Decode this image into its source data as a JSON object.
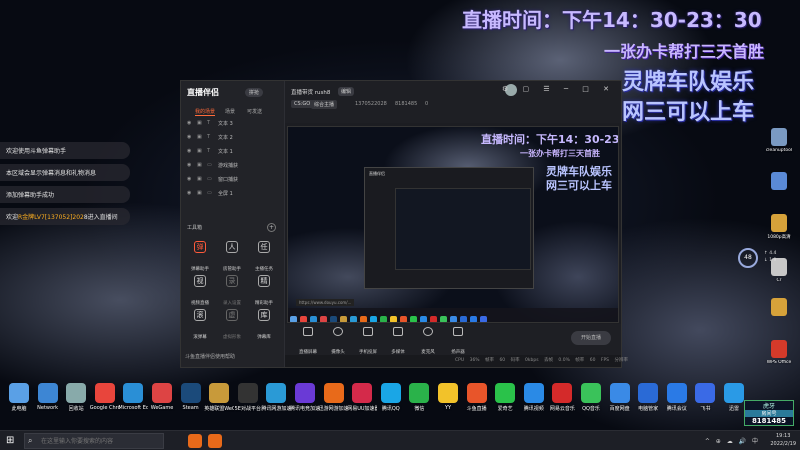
{
  "overlay": {
    "time": "直播时间：下午14：30-23：30",
    "promo": "一张办卡帮打三天首胜",
    "team": "灵牌车队娱乐",
    "net": "网三可以上车"
  },
  "chat": [
    {
      "text": "欢迎使用斗鱼弹幕助手"
    },
    {
      "text": "本区域会显示弹幕消息和礼物消息"
    },
    {
      "text": "添加弹幕助手成功"
    },
    {
      "prefix": "欢迎",
      "highlight": "R金牌LV7",
      "mid": "[137052]202",
      "suffix": "8进入直播间"
    }
  ],
  "app": {
    "logo": "直播伴侣",
    "logo_badge": "拼抢",
    "sidebar_tabs": [
      "我的场景",
      "场景",
      "可发送"
    ],
    "sources": [
      {
        "type": "T",
        "name": "文本 3"
      },
      {
        "type": "T",
        "name": "文本 2"
      },
      {
        "type": "T",
        "name": "文本 1"
      },
      {
        "type": "▭",
        "name": "游戏捕获"
      },
      {
        "type": "▭",
        "name": "窗口捕获"
      },
      {
        "type": "▭",
        "name": "全屏 1"
      }
    ],
    "toolbox_title": "工具箱",
    "tools": [
      {
        "label": "弹幕助手",
        "icon": "弹",
        "style": "red"
      },
      {
        "label": "房管助手",
        "icon": "人",
        "style": ""
      },
      {
        "label": "主播任务",
        "icon": "任",
        "style": ""
      },
      {
        "label": "视频直播",
        "icon": "视",
        "style": ""
      },
      {
        "label": "录入设置",
        "icon": "录",
        "style": "dim"
      },
      {
        "label": "精彩助手",
        "icon": "精",
        "style": ""
      },
      {
        "label": "滚弹幕",
        "icon": "滚",
        "style": ""
      },
      {
        "label": "虚拟形象",
        "icon": "虚",
        "style": "dim"
      },
      {
        "label": "弹幕库",
        "icon": "库",
        "style": ""
      }
    ],
    "helper_text": "斗鱼直播伴侣使用帮助",
    "room_title": "直播带货 rush8",
    "room_badge": "编辑",
    "game_tag": "CS:GO",
    "cat_tag": "综合主播",
    "room_id": "1370522028",
    "hot": "8181485",
    "fans": "0",
    "window_controls": "⚙ ▢ ☰ ─ □ ✕",
    "controls": [
      {
        "label": "直播屏幕"
      },
      {
        "label": "摄像头"
      },
      {
        "label": "手机投屏"
      },
      {
        "label": "多媒体"
      },
      {
        "label": "麦克风"
      },
      {
        "label": "扬声器"
      }
    ],
    "start_button": "开始直播",
    "status": "CPU 36% 帧率 60  码率 0kbps  丢帧 0.0%  帧率 60 FPS  分辨率"
  },
  "preview": {
    "time": "直播时间：下午14：30-23：30",
    "promo": "一张办卡帮打三天首胜",
    "team": "灵牌车队娱乐",
    "net": "网三可以上车",
    "inner_title": "直播伴侣",
    "url": "https://www.douyu.com/..."
  },
  "desktop_icons": [
    {
      "label": "此电脑",
      "color": "#5aa0e6"
    },
    {
      "label": "Network",
      "color": "#3d86d4"
    },
    {
      "label": "回收站",
      "color": "#8aa"
    },
    {
      "label": "Google Chrome",
      "color": "#e8453c"
    },
    {
      "label": "Microsoft Edge",
      "color": "#2a8fd6"
    },
    {
      "label": "WeGame",
      "color": "#d44"
    },
    {
      "label": "Steam",
      "color": "#1b4a7a"
    },
    {
      "label": "英雄联盟WeGame版",
      "color": "#c89a3a"
    },
    {
      "label": "5E对战平台",
      "color": "#333"
    },
    {
      "label": "腾讯网游加速器",
      "color": "#2a9ad6"
    },
    {
      "label": "腾讯电竞加速器",
      "color": "#6a3ad6"
    },
    {
      "label": "迅游网游加速器",
      "color": "#e86a1a"
    },
    {
      "label": "网易UU加速器",
      "color": "#d42a4a"
    },
    {
      "label": "腾讯QQ",
      "color": "#1aa6e6"
    },
    {
      "label": "微信",
      "color": "#2ab24a"
    },
    {
      "label": "YY",
      "color": "#f2c22a"
    },
    {
      "label": "斗鱼直播",
      "color": "#e8552a"
    },
    {
      "label": "爱奇艺",
      "color": "#2ac24a"
    },
    {
      "label": "腾讯视频",
      "color": "#2a8ae6"
    },
    {
      "label": "网易云音乐",
      "color": "#d42a2a"
    },
    {
      "label": "QQ音乐",
      "color": "#3ac25a"
    },
    {
      "label": "百度网盘",
      "color": "#3a8ae6"
    },
    {
      "label": "电脑管家",
      "color": "#2a6ad6"
    },
    {
      "label": "腾讯会议",
      "color": "#2a7ae6"
    },
    {
      "label": "飞书",
      "color": "#3a6ae6"
    },
    {
      "label": "迅雷",
      "color": "#2a9ae6"
    }
  ],
  "right_icons": [
    {
      "label": "cleanuptool",
      "color": "#7a9ac2"
    },
    {
      "label": "",
      "color": "#5a8ad6"
    },
    {
      "label": "1080p高清",
      "color": "#d6a23a"
    },
    {
      "label": "Cr",
      "color": "#c8c8c8"
    },
    {
      "label": "",
      "color": "#d6a23a"
    },
    {
      "label": "WPS Office",
      "color": "#d43a2a"
    }
  ],
  "gauge": {
    "value": "48",
    "unit": "%",
    "line1": "↑ 4.4",
    "line2": "↓ 1.9"
  },
  "room_badge": {
    "logo": "虎牙",
    "label": "房间号",
    "number": "8181485"
  },
  "taskbar": {
    "search_placeholder": "在这里输入你要搜索的内容",
    "tray": "^ ⊕ ☁ 🔊 中",
    "time": "19:13",
    "date": "2022/2/19",
    "apps": [
      "#e86a1a",
      "#e86a1a"
    ]
  }
}
